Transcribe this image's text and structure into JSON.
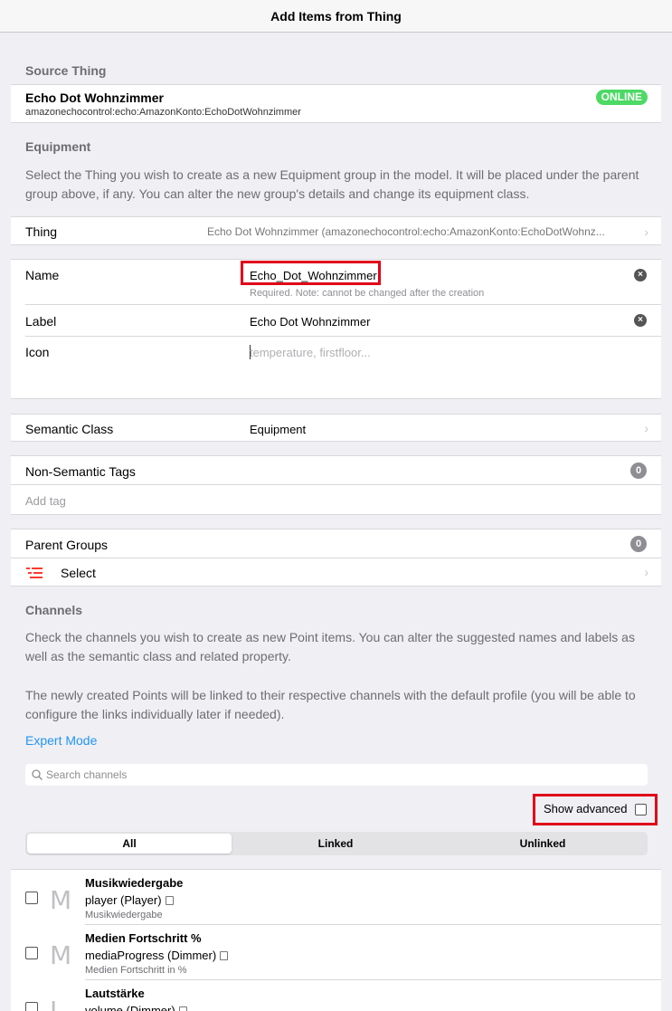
{
  "nav": {
    "title": "Add Items from Thing"
  },
  "source": {
    "title": "Source Thing",
    "thing_name": "Echo Dot Wohnzimmer",
    "thing_uid": "amazonechocontrol:echo:AmazonKonto:EchoDotWohnzimmer",
    "status": "ONLINE",
    "status_color": "#4cd964"
  },
  "equipment": {
    "title": "Equipment",
    "description": "Select the Thing you wish to create as a new Equipment group in the model. It will be placed under the parent group above, if any. You can alter the new group's details and change its equipment class.",
    "thing_label": "Thing",
    "thing_value": "Echo Dot Wohnzimmer (amazonechocontrol:echo:AmazonKonto:EchoDotWohnz..."
  },
  "form": {
    "name_label": "Name",
    "name_value": "Echo_Dot_Wohnzimmer",
    "name_hint": "Required. Note: cannot be changed after the creation",
    "label_label": "Label",
    "label_value": "Echo Dot Wohnzimmer",
    "icon_label": "Icon",
    "icon_placeholder": "temperature, firstfloor..."
  },
  "semantic": {
    "label": "Semantic Class",
    "value": "Equipment"
  },
  "tags": {
    "label": "Non-Semantic Tags",
    "count": "0",
    "add_placeholder": "Add tag"
  },
  "parent_groups": {
    "label": "Parent Groups",
    "count": "0",
    "select_label": "Select"
  },
  "channels": {
    "title": "Channels",
    "description1": "Check the channels you wish to create as new Point items. You can alter the suggested names and labels as well as the semantic class and related property.",
    "description2": "The newly created Points will be linked to their respective channels with the default profile (you will be able to configure the links individually later if needed).",
    "expert_mode": "Expert Mode",
    "search_placeholder": "Search channels",
    "show_advanced": "Show advanced",
    "tabs": [
      "All",
      "Linked",
      "Unlinked"
    ],
    "items": [
      {
        "letter": "M",
        "title": "Musikwiedergabe",
        "sub": "player (Player)",
        "foot": "Musikwiedergabe"
      },
      {
        "letter": "M",
        "title": "Medien Fortschritt %",
        "sub": "mediaProgress (Dimmer)",
        "foot": "Medien Fortschritt in %"
      },
      {
        "letter": "L",
        "title": "Lautstärke",
        "sub": "volume (Dimmer)",
        "foot": ""
      }
    ]
  },
  "colors": {
    "accent": "#2196f3",
    "highlight": "#e0001a",
    "select_icon": "#ff3b30"
  }
}
